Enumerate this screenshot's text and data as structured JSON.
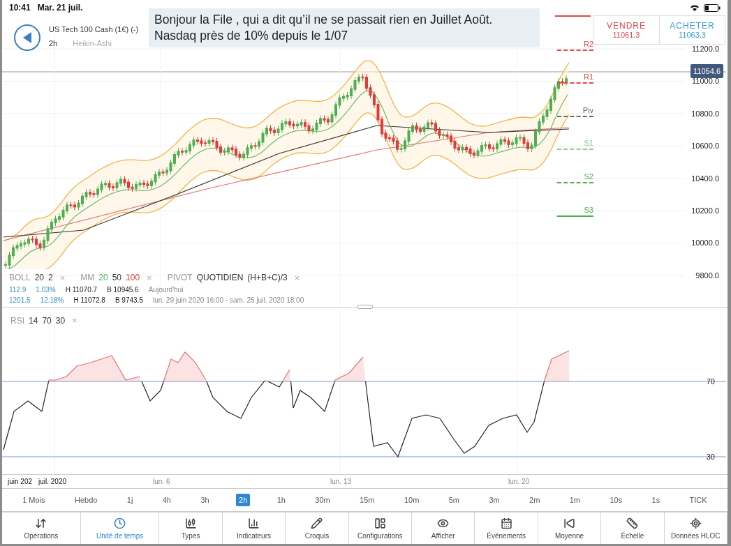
{
  "status_bar": {
    "time": "10:41",
    "date": "Mar. 21 juil."
  },
  "instrument": {
    "name": "US Tech 100 Cash (1€) (-)",
    "timeframe": "2h",
    "chart_type": "Heikin-Ashi"
  },
  "comment": {
    "lines": [
      "Bonjour la File , qui a dit qu’il ne se passait rien en Juillet Août.",
      "Nasdaq près de 10% depuis le 1/07"
    ]
  },
  "trade": [
    {
      "label": "VENDRE",
      "price": "11061.3",
      "color": "#e0474c"
    },
    {
      "label": "ACHETER",
      "price": "11063.3",
      "color": "#3a9ad9"
    }
  ],
  "current_price": "11054.6",
  "price_axis": [
    "11200.0",
    "11000.0",
    "10800.0",
    "10600.0",
    "10400.0",
    "10200.0",
    "10000.0",
    "9800.0"
  ],
  "pivots": [
    {
      "label": "R2",
      "color": "#e0474c",
      "kind": "dashed"
    },
    {
      "label": "R1",
      "color": "#e0474c",
      "kind": "dashed"
    },
    {
      "label": "Piv",
      "color": "#666666",
      "kind": "dashed"
    },
    {
      "label": "S1",
      "color": "#8fd08f",
      "kind": "dashed"
    },
    {
      "label": "S2",
      "color": "#4caf50",
      "kind": "dashed"
    },
    {
      "label": "S3",
      "color": "#4caf50",
      "kind": "solid"
    }
  ],
  "indicators": [
    {
      "name": "BOLL",
      "params": [
        {
          "text": "20",
          "color": "#333333"
        },
        {
          "text": "2",
          "color": "#333333"
        }
      ],
      "close": "×"
    },
    {
      "name": "MM",
      "params": [
        {
          "text": "20",
          "color": "#4caf50"
        },
        {
          "text": "50",
          "color": "#333333"
        },
        {
          "text": "100",
          "color": "#e53935"
        }
      ],
      "close": "×"
    },
    {
      "name": "PIVOT",
      "params": [
        {
          "text": "QUOTIDIEN",
          "color": "#333333"
        },
        {
          "text": "(H+B+C)/3",
          "color": "#333333"
        }
      ],
      "close": "×"
    }
  ],
  "stats": [
    {
      "change": "112.9",
      "percent": "1.03%",
      "high": "H 11070.7",
      "low": "B 10945.6",
      "period": "Aujourd'hui"
    },
    {
      "change": "1201.5",
      "percent": "12.18%",
      "high": "H 11072.8",
      "low": "B 9743.5",
      "period": "lun. 29 juin 2020 16:00 - sam. 25 juil. 2020 18:00"
    }
  ],
  "rsi": {
    "name": "RSI",
    "params": [
      "14",
      "70",
      "30"
    ],
    "close": "×",
    "levels": [
      "70",
      "30"
    ]
  },
  "date_axis": [
    "juin 202",
    "juil. 2020",
    "lun. 6",
    "lun. 13",
    "lun. 20"
  ],
  "timeframes": [
    {
      "label": "1 Mois",
      "selected": false
    },
    {
      "label": "Hebdo",
      "selected": false
    },
    {
      "label": "1j",
      "selected": false
    },
    {
      "label": "4h",
      "selected": false
    },
    {
      "label": "3h",
      "selected": false
    },
    {
      "label": "2h",
      "selected": true
    },
    {
      "label": "1h",
      "selected": false
    },
    {
      "label": "30m",
      "selected": false
    },
    {
      "label": "15m",
      "selected": false
    },
    {
      "label": "10m",
      "selected": false
    },
    {
      "label": "5m",
      "selected": false
    },
    {
      "label": "3m",
      "selected": false
    },
    {
      "label": "2m",
      "selected": false
    },
    {
      "label": "1m",
      "selected": false
    },
    {
      "label": "10s",
      "selected": false
    },
    {
      "label": "1s",
      "selected": false
    },
    {
      "label": "TICK",
      "selected": false
    }
  ],
  "toolbar": [
    {
      "label": "Opérations",
      "selected": false
    },
    {
      "label": "Unité de temps",
      "selected": true
    },
    {
      "label": "Types",
      "selected": false
    },
    {
      "label": "Indicateurs",
      "selected": false
    },
    {
      "label": "Croquis",
      "selected": false
    },
    {
      "label": "Configurations",
      "selected": false
    },
    {
      "label": "Afficher",
      "selected": false
    },
    {
      "label": "Événements",
      "selected": false
    },
    {
      "label": "Moyenne",
      "selected": false
    },
    {
      "label": "Échelle",
      "selected": false
    },
    {
      "label": "Données HLOC",
      "selected": false
    }
  ]
}
